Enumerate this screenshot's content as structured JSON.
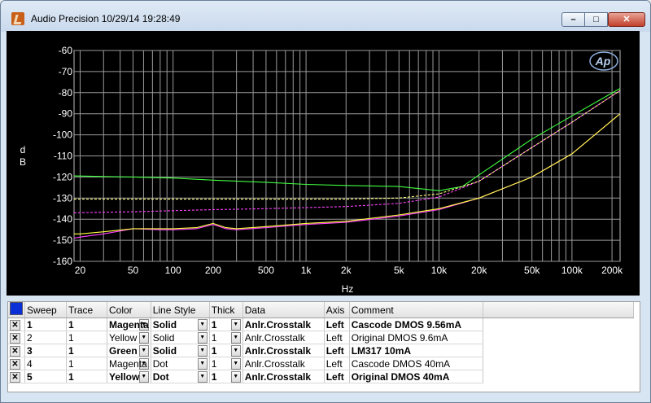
{
  "window": {
    "title": "Audio Precision  10/29/14 19:28:49",
    "buttons": {
      "minimize": "–",
      "maximize": "□",
      "close": "✕"
    }
  },
  "chart_data": {
    "type": "line",
    "logo": "Ap",
    "ylabel": "d\nB",
    "xlabel": "Hz",
    "x_log": true,
    "xlim": [
      18,
      230000
    ],
    "ylim": [
      -160,
      -60
    ],
    "xticks": [
      20,
      50,
      100,
      200,
      500,
      1000,
      2000,
      5000,
      10000,
      20000,
      50000,
      100000,
      200000
    ],
    "xtick_labels": [
      "20",
      "50",
      "100",
      "200",
      "500",
      "1k",
      "2k",
      "5k",
      "10k",
      "20k",
      "50k",
      "100k",
      "200k"
    ],
    "yticks": [
      -60,
      -70,
      -80,
      -90,
      -100,
      -110,
      -120,
      -130,
      -140,
      -150,
      -160
    ],
    "grid": true,
    "series": [
      {
        "color": "#ff40ff",
        "style": "solid",
        "x": [
          18,
          20,
          30,
          50,
          80,
          100,
          150,
          200,
          250,
          300,
          500,
          1000,
          2000,
          5000,
          10000,
          20000,
          50000,
          100000,
          230000
        ],
        "y": [
          -149,
          -148.5,
          -147,
          -144.5,
          -145,
          -145,
          -144.5,
          -142.5,
          -144.5,
          -145,
          -144,
          -142.5,
          -141.5,
          -138.5,
          -135.5,
          -130,
          -120,
          -109,
          -90
        ]
      },
      {
        "color": "#ffff40",
        "style": "solid",
        "x": [
          18,
          20,
          30,
          50,
          80,
          100,
          150,
          200,
          250,
          300,
          500,
          1000,
          2000,
          5000,
          10000,
          20000,
          50000,
          100000,
          230000
        ],
        "y": [
          -147,
          -147,
          -146,
          -144.5,
          -144.5,
          -144.5,
          -144,
          -142,
          -144,
          -144.5,
          -143.5,
          -142,
          -141,
          -138,
          -135,
          -130,
          -120,
          -109,
          -90
        ]
      },
      {
        "color": "#40ff40",
        "style": "solid",
        "x": [
          18,
          50,
          100,
          200,
          500,
          1000,
          2000,
          5000,
          10000,
          15000,
          20000,
          50000,
          100000,
          230000
        ],
        "y": [
          -119.5,
          -120,
          -120.5,
          -121.5,
          -122.5,
          -123.5,
          -124,
          -124.5,
          -126.5,
          -124.5,
          -119,
          -102,
          -91,
          -78
        ]
      },
      {
        "color": "#ff40ff",
        "style": "dash",
        "x": [
          18,
          50,
          100,
          200,
          500,
          1000,
          2000,
          5000,
          10000,
          20000,
          50000,
          100000,
          230000
        ],
        "y": [
          -137,
          -136.5,
          -136,
          -135.5,
          -135,
          -134.5,
          -134,
          -132.5,
          -129.5,
          -122,
          -106,
          -94,
          -79
        ]
      },
      {
        "color": "#ffff80",
        "style": "dash",
        "x": [
          18,
          50,
          100,
          200,
          500,
          1000,
          2000,
          5000,
          10000,
          20000,
          50000,
          100000,
          230000
        ],
        "y": [
          -130.5,
          -130.5,
          -130.5,
          -130.5,
          -130.5,
          -130.5,
          -130.5,
          -130,
          -128,
          -122,
          -106,
          -94,
          -79
        ]
      }
    ]
  },
  "table": {
    "headers": [
      "Sweep",
      "Trace",
      "Color",
      "Line Style",
      "Thick",
      "Data",
      "Axis",
      "Comment"
    ],
    "rows": [
      {
        "checked": "✕",
        "sweep": "1",
        "trace": "1",
        "color": "Magenta",
        "style": "Solid",
        "thick": "1",
        "data": "Anlr.Crosstalk",
        "axis": "Left",
        "comment": "Cascode DMOS 9.56mA",
        "bold": true
      },
      {
        "checked": "✕",
        "sweep": "2",
        "trace": "1",
        "color": "Yellow",
        "style": "Solid",
        "thick": "1",
        "data": "Anlr.Crosstalk",
        "axis": "Left",
        "comment": "Original DMOS 9.6mA",
        "bold": false
      },
      {
        "checked": "✕",
        "sweep": "3",
        "trace": "1",
        "color": "Green",
        "style": "Solid",
        "thick": "1",
        "data": "Anlr.Crosstalk",
        "axis": "Left",
        "comment": "LM317 10mA",
        "bold": true
      },
      {
        "checked": "✕",
        "sweep": "4",
        "trace": "1",
        "color": "Magenta",
        "style": "Dot",
        "thick": "1",
        "data": "Anlr.Crosstalk",
        "axis": "Left",
        "comment": "Cascode DMOS 40mA",
        "bold": false
      },
      {
        "checked": "✕",
        "sweep": "5",
        "trace": "1",
        "color": "Yellow",
        "style": "Dot",
        "thick": "1",
        "data": "Anlr.Crosstalk",
        "axis": "Left",
        "comment": "Original DMOS 40mA",
        "bold": true
      }
    ]
  },
  "colors": {
    "plot_bg": "#000000",
    "grid": "#9a9a9a",
    "select_blue": "#0a2fd6"
  }
}
